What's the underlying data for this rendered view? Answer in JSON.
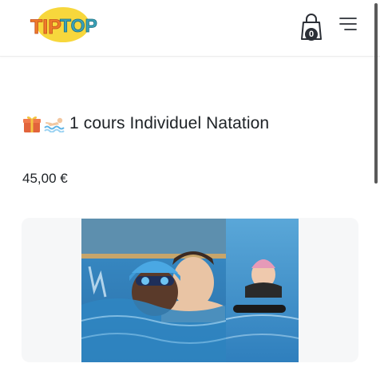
{
  "header": {
    "logo_text": "TIPTOP",
    "cart_count": "0",
    "colors": {
      "logo_yellow": "#f7d73c",
      "logo_orange": "#ef7a2a",
      "logo_teal": "#3aa2b8"
    }
  },
  "product": {
    "title": "1 cours Individuel Natation",
    "price": "45,00 €",
    "icons": [
      "gift-icon",
      "swimmer-icon"
    ]
  }
}
